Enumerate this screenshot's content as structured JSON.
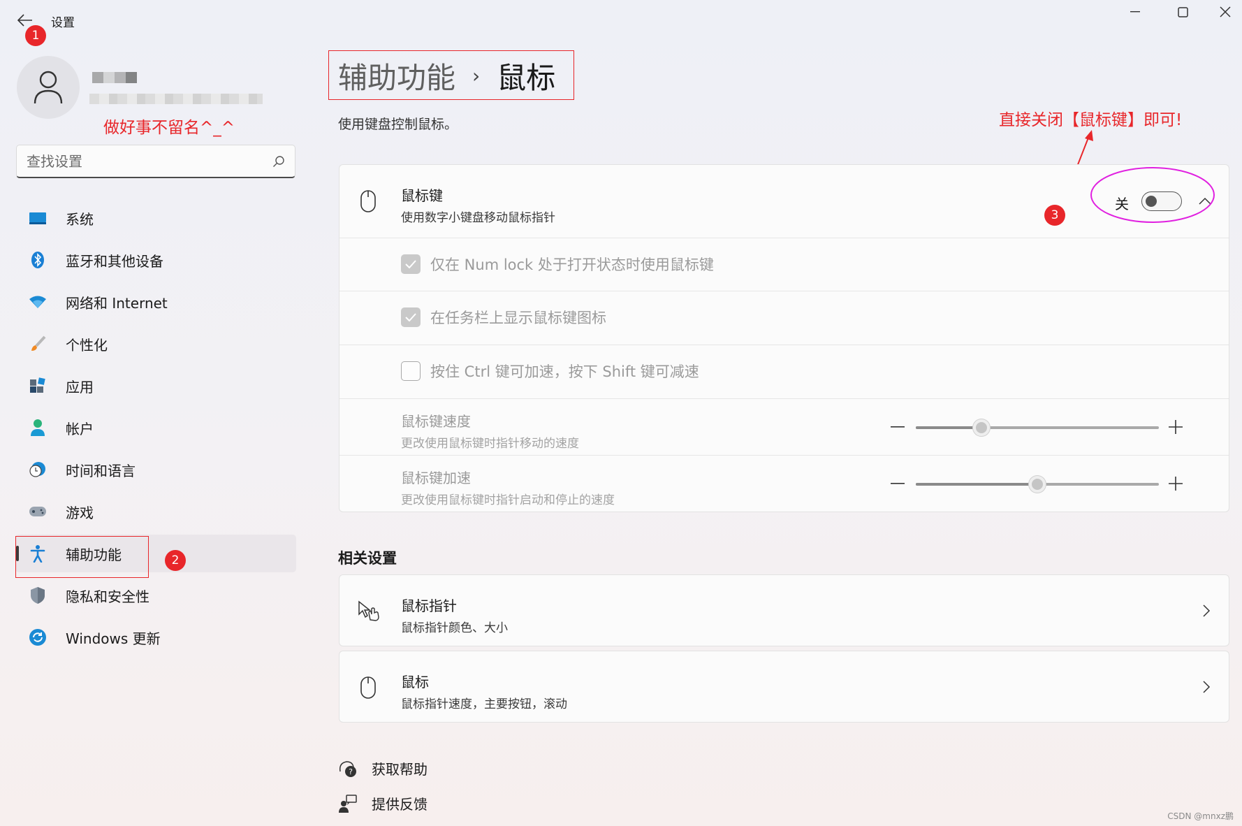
{
  "window": {
    "title": "设置"
  },
  "annotations": {
    "badge1": "1",
    "badge2": "2",
    "badge3": "3",
    "profile_note": "做好事不留名^_^",
    "instruction": "直接关闭【鼠标键】即可!"
  },
  "search": {
    "placeholder": "查找设置"
  },
  "nav": {
    "items": [
      {
        "label": "系统",
        "icon": "system-display-icon"
      },
      {
        "label": "蓝牙和其他设备",
        "icon": "bluetooth-icon"
      },
      {
        "label": "网络和 Internet",
        "icon": "wifi-icon"
      },
      {
        "label": "个性化",
        "icon": "paintbrush-icon"
      },
      {
        "label": "应用",
        "icon": "apps-icon"
      },
      {
        "label": "帐户",
        "icon": "account-icon"
      },
      {
        "label": "时间和语言",
        "icon": "clock-globe-icon"
      },
      {
        "label": "游戏",
        "icon": "gamepad-icon"
      },
      {
        "label": "辅助功能",
        "icon": "accessibility-icon",
        "active": true
      },
      {
        "label": "隐私和安全性",
        "icon": "shield-icon"
      },
      {
        "label": "Windows 更新",
        "icon": "update-icon"
      }
    ]
  },
  "header": {
    "parent": "辅助功能",
    "separator": "›",
    "current": "鼠标",
    "subtitle": "使用键盘控制鼠标。"
  },
  "mouse_keys": {
    "title": "鼠标键",
    "description": "使用数字小键盘移动鼠标指针",
    "state_label": "关",
    "enabled": false
  },
  "options": [
    {
      "label": "仅在 Num lock 处于打开状态时使用鼠标键",
      "checked": true
    },
    {
      "label": "在任务栏上显示鼠标键图标",
      "checked": true
    },
    {
      "label": "按住 Ctrl 键可加速，按下 Shift 键可减速",
      "checked": false
    }
  ],
  "sliders": [
    {
      "title": "鼠标键速度",
      "description": "更改使用鼠标键时指针移动的速度",
      "value_pct": 27
    },
    {
      "title": "鼠标键加速",
      "description": "更改使用鼠标键时指针启动和停止的速度",
      "value_pct": 50
    }
  ],
  "related": {
    "title": "相关设置",
    "items": [
      {
        "title": "鼠标指针",
        "description": "鼠标指针颜色、大小"
      },
      {
        "title": "鼠标",
        "description": "鼠标指针速度，主要按钮，滚动"
      }
    ]
  },
  "footer": {
    "help": "获取帮助",
    "feedback": "提供反馈"
  },
  "watermark": "CSDN @mnxz鹏",
  "colors": {
    "annotation_red": "#e8262a",
    "highlight_magenta": "#e020e0"
  }
}
